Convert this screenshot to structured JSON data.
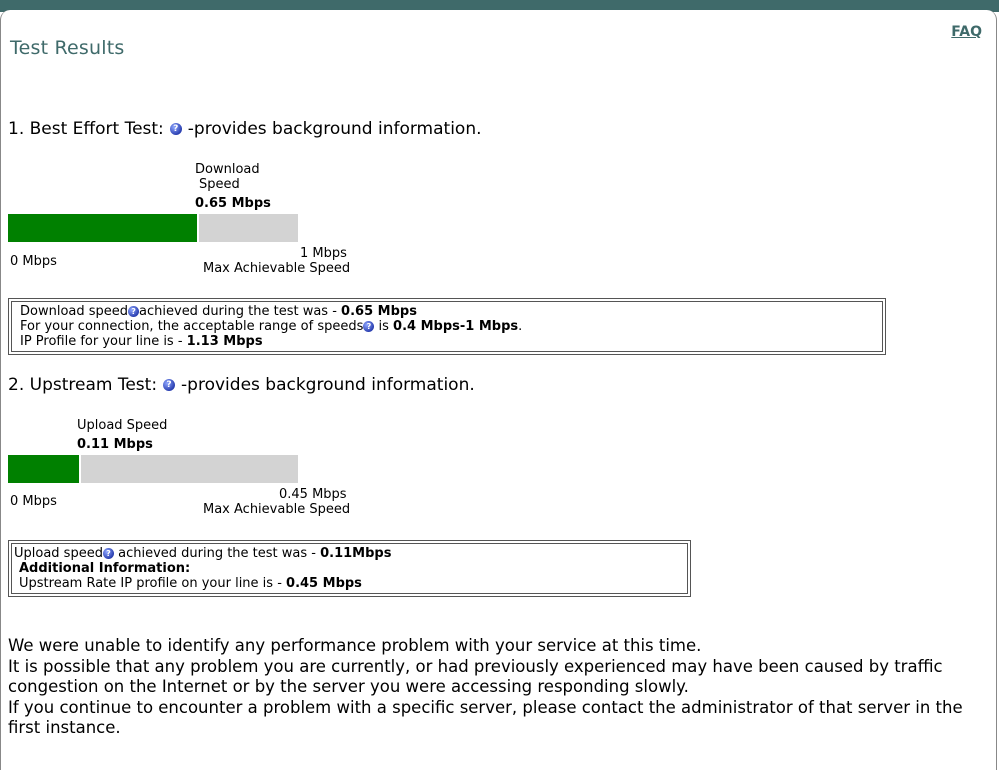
{
  "page": {
    "title": "Test Results",
    "faq_label": "FAQ"
  },
  "best_effort": {
    "heading": "1. Best Effort Test:",
    "heading_suffix": "-provides background information.",
    "speed_label_line1": "Download",
    "speed_label_line2": "Speed",
    "speed_value": "0.65 Mbps",
    "bar_fraction": 0.65,
    "min_label": "0 Mbps",
    "max_value": "1 Mbps",
    "max_label": "Max Achievable Speed",
    "info": {
      "line1_prefix": "Download speed",
      "line1_mid": "achieved during the test was - ",
      "line1_value": "0.65 Mbps",
      "line2_prefix": "For your connection, the acceptable range of speeds",
      "line2_mid": " is ",
      "line2_value": "0.4 Mbps-1 Mbps",
      "line2_end": ".",
      "line3_prefix": "IP Profile for your line is - ",
      "line3_value": "1.13 Mbps"
    }
  },
  "upstream": {
    "heading": "2. Upstream Test:",
    "heading_suffix": "-provides background information.",
    "speed_label": "Upload Speed",
    "speed_value": "0.11 Mbps",
    "bar_fraction": 0.2444,
    "min_label": "0 Mbps",
    "max_value": "0.45 Mbps",
    "max_label": "Max Achievable Speed",
    "info": {
      "line1_prefix": "Upload speed",
      "line1_mid": " achieved during the test was - ",
      "line1_value": "0.11Mbps",
      "line2": "Additional Information:",
      "line3_prefix": "Upstream Rate IP profile on your line is - ",
      "line3_value": "0.45 Mbps"
    }
  },
  "summary": {
    "line1": "We were unable to identify any performance problem with your service at this time.",
    "line2": "It is possible that any problem you are currently, or had previously experienced may have been caused by traffic congestion on the Internet or by the server you were accessing responding slowly.",
    "line3": "If you continue to encounter a problem with a specific server, please contact the administrator of that server in the first instance."
  },
  "colors": {
    "accent": "#3f6a6a",
    "bar_fill": "#008000",
    "bar_track": "#d3d3d3",
    "help_icon": "#2a3fb0"
  },
  "icons": {
    "help": "help-icon"
  }
}
